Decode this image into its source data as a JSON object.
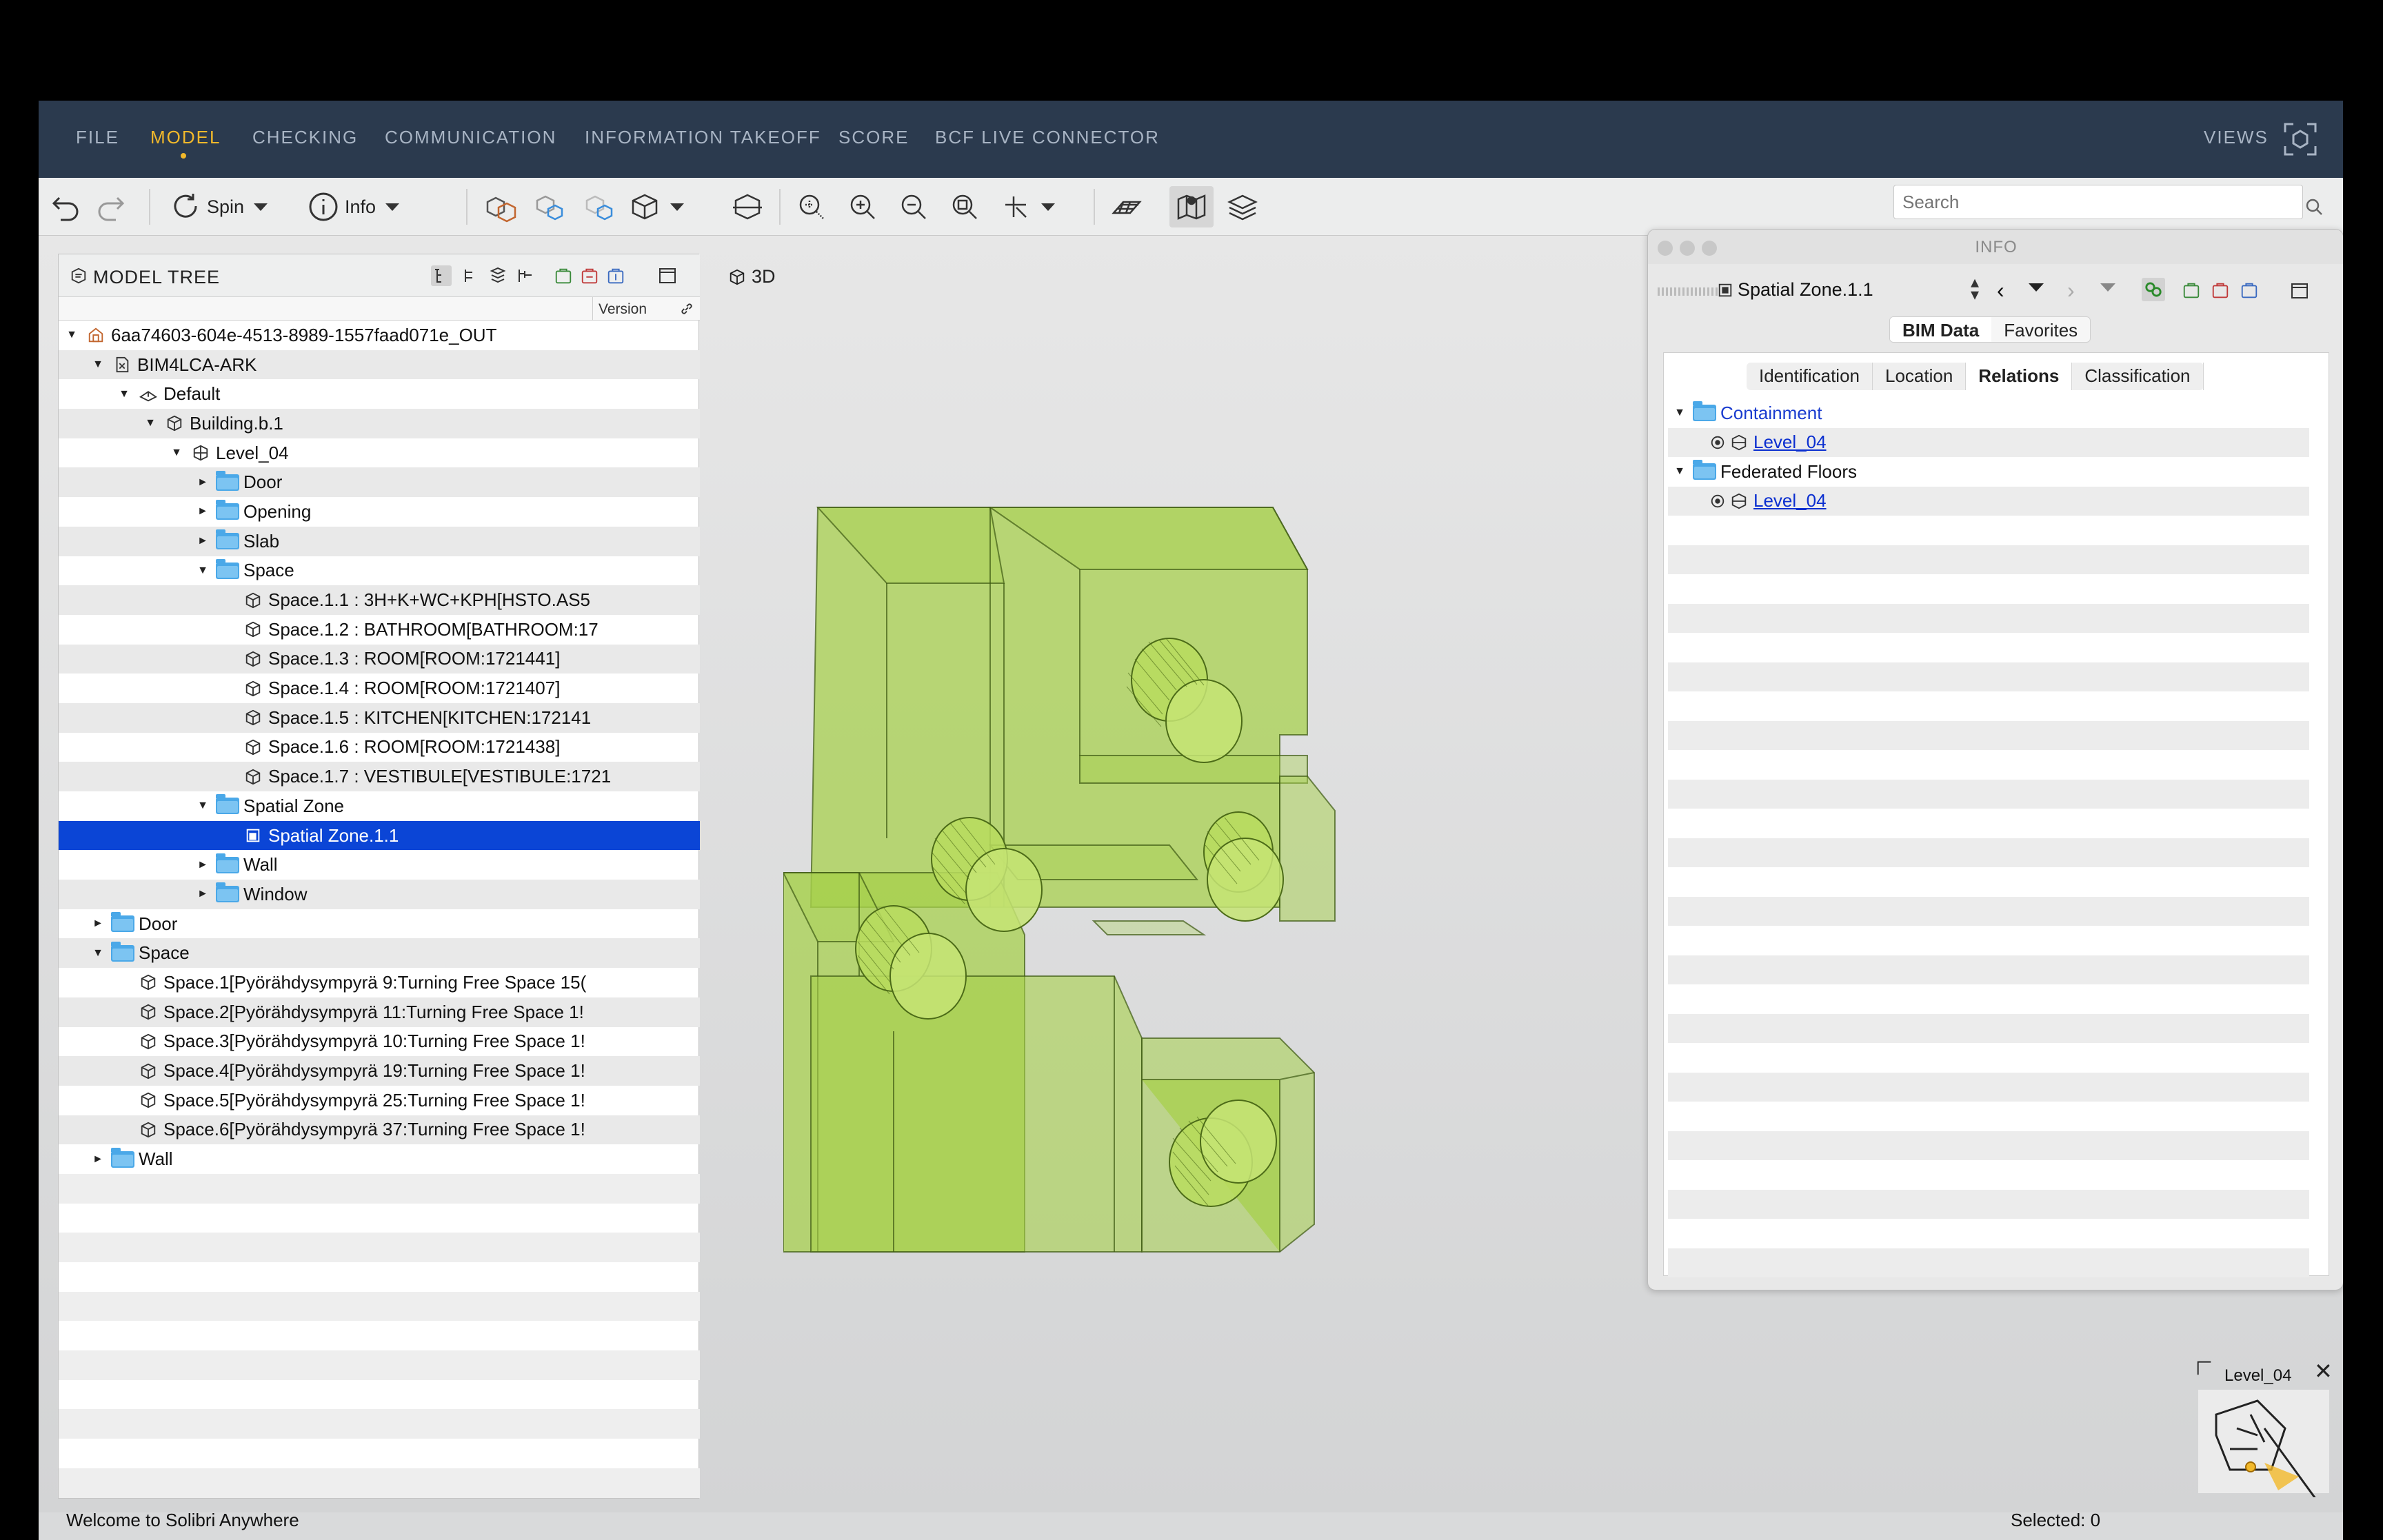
{
  "menu": {
    "items": [
      "FILE",
      "MODEL",
      "CHECKING",
      "COMMUNICATION",
      "INFORMATION TAKEOFF",
      "SCORE",
      "BCF LIVE CONNECTOR"
    ],
    "active": "MODEL",
    "views_label": "VIEWS"
  },
  "toolbar": {
    "spin_label": "Spin",
    "info_label": "Info",
    "search_placeholder": "Search"
  },
  "viewport": {
    "label": "3D"
  },
  "tree": {
    "title": "MODEL TREE",
    "version_col": "Version",
    "rows": [
      {
        "label": "6aa74603-604e-4513-8989-1557faad071e_OUT"
      },
      {
        "label": "BIM4LCA-ARK"
      },
      {
        "label": "Default"
      },
      {
        "label": "Building.b.1"
      },
      {
        "label": "Level_04"
      },
      {
        "label": "Door"
      },
      {
        "label": "Opening"
      },
      {
        "label": "Slab"
      },
      {
        "label": "Space"
      },
      {
        "label": "Space.1.1 : 3H+K+WC+KPH[HSTO.AS5"
      },
      {
        "label": "Space.1.2 : BATHROOM[BATHROOM:17"
      },
      {
        "label": "Space.1.3 : ROOM[ROOM:1721441]"
      },
      {
        "label": "Space.1.4 : ROOM[ROOM:1721407]"
      },
      {
        "label": "Space.1.5 : KITCHEN[KITCHEN:172141"
      },
      {
        "label": "Space.1.6 : ROOM[ROOM:1721438]"
      },
      {
        "label": "Space.1.7 : VESTIBULE[VESTIBULE:1721"
      },
      {
        "label": "Spatial Zone"
      },
      {
        "label": "Spatial Zone.1.1"
      },
      {
        "label": "Wall"
      },
      {
        "label": "Window"
      },
      {
        "label": "Door"
      },
      {
        "label": "Space"
      },
      {
        "label": "Space.1[Pyörähdysympyrä 9:Turning Free Space 15("
      },
      {
        "label": "Space.2[Pyörähdysympyrä 11:Turning Free Space 1!"
      },
      {
        "label": "Space.3[Pyörähdysympyrä 10:Turning Free Space 1!"
      },
      {
        "label": "Space.4[Pyörähdysympyrä 19:Turning Free Space 1!"
      },
      {
        "label": "Space.5[Pyörähdysympyrä 25:Turning Free Space 1!"
      },
      {
        "label": "Space.6[Pyörähdysympyrä 37:Turning Free Space 1!"
      },
      {
        "label": "Wall"
      }
    ]
  },
  "info": {
    "title": "INFO",
    "selected_name": "Spatial Zone.1.1",
    "tabs_top": [
      "BIM Data",
      "Favorites"
    ],
    "tabs_sub": [
      "Identification",
      "Location",
      "Relations",
      "Classification"
    ],
    "relations": [
      {
        "label": "Containment"
      },
      {
        "label": "Level_04"
      },
      {
        "label": "Federated Floors"
      },
      {
        "label": "Level_04"
      }
    ]
  },
  "minimap": {
    "label": "Level_04"
  },
  "status": {
    "message": "Welcome to Solibri Anywhere",
    "selected": "Selected: 0"
  },
  "colors": {
    "menubar": "#2b3a4e",
    "menu_active": "#f2b92b",
    "selection": "#0b45d6",
    "model_green": "#a6d04a"
  }
}
